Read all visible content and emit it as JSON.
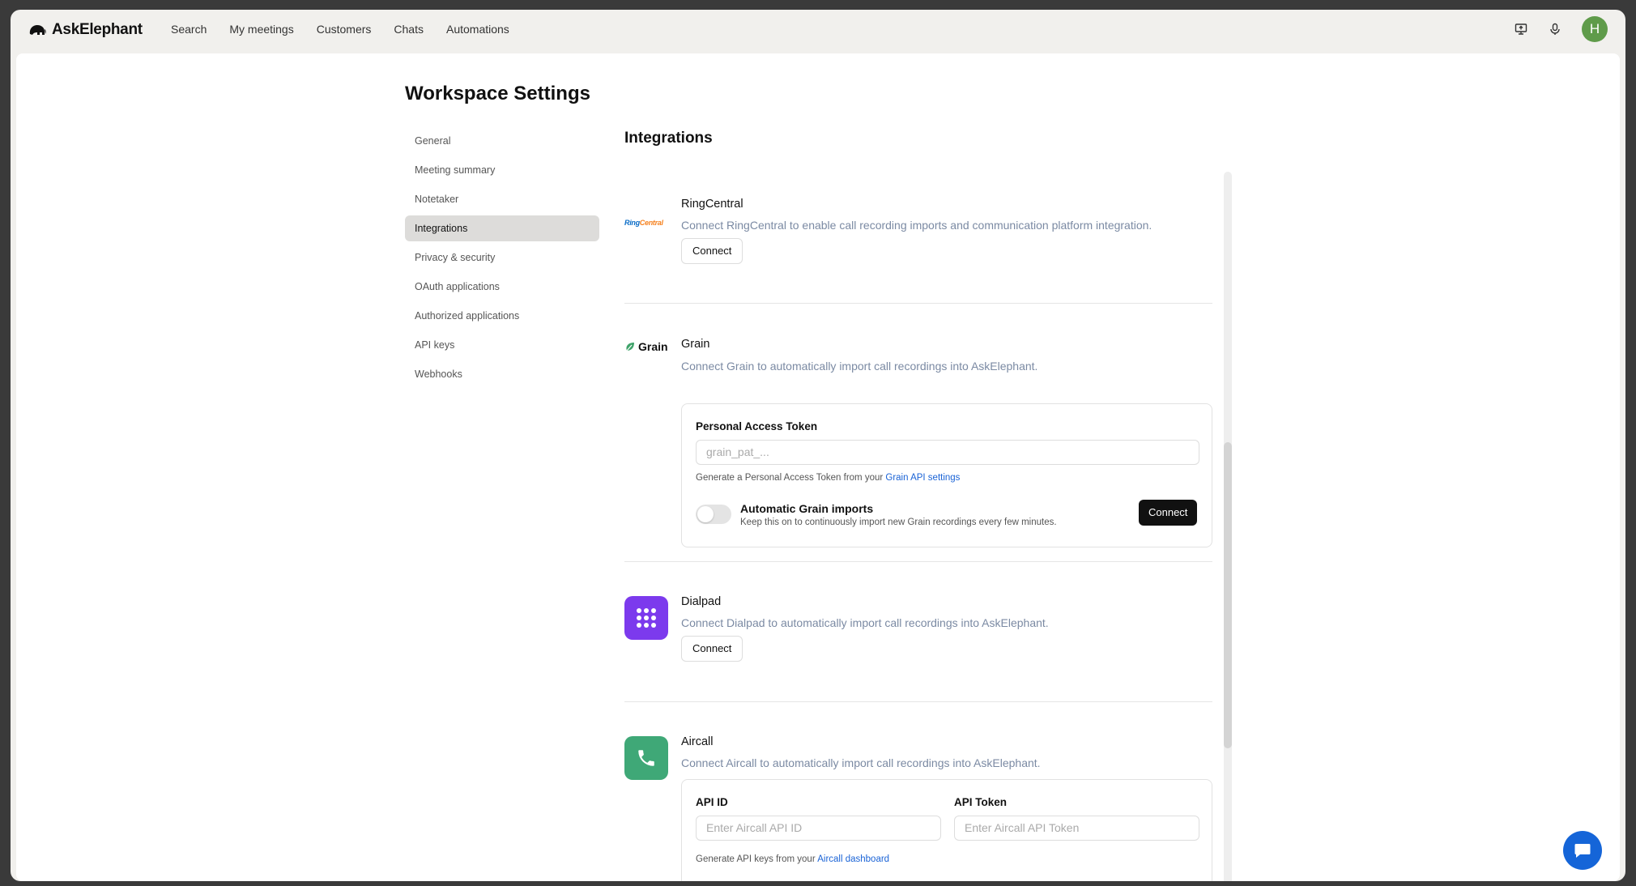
{
  "app": {
    "name": "AskElephant",
    "avatar_initial": "H",
    "avatar_color": "#5f9b4a"
  },
  "nav": {
    "items": [
      "Search",
      "My meetings",
      "Customers",
      "Chats",
      "Automations"
    ]
  },
  "page": {
    "title": "Workspace Settings",
    "section_title": "Integrations"
  },
  "sidebar": {
    "items": [
      {
        "label": "General",
        "active": false
      },
      {
        "label": "Meeting summary",
        "active": false
      },
      {
        "label": "Notetaker",
        "active": false
      },
      {
        "label": "Integrations",
        "active": true
      },
      {
        "label": "Privacy & security",
        "active": false
      },
      {
        "label": "OAuth applications",
        "active": false
      },
      {
        "label": "Authorized applications",
        "active": false
      },
      {
        "label": "API keys",
        "active": false
      },
      {
        "label": "Webhooks",
        "active": false
      }
    ]
  },
  "integrations": {
    "ringcentral": {
      "logo_text": "Ring",
      "logo_text_accent": "Central",
      "name": "RingCentral",
      "description": "Connect RingCentral to enable call recording imports and communication platform integration.",
      "button": "Connect"
    },
    "grain": {
      "logo_text": "Grain",
      "name": "Grain",
      "description": "Connect Grain to automatically import call recordings into AskElephant.",
      "token_label": "Personal Access Token",
      "token_placeholder": "grain_pat_...",
      "hint_prefix": "Generate a Personal Access Token from your",
      "hint_link": "Grain API settings",
      "toggle_title": "Automatic Grain imports",
      "toggle_desc": "Keep this on to continuously import new Grain recordings every few minutes.",
      "toggle_on": false,
      "button": "Connect"
    },
    "dialpad": {
      "name": "Dialpad",
      "description": "Connect Dialpad to automatically import call recordings into AskElephant.",
      "button": "Connect",
      "icon_color": "#7c3aed"
    },
    "aircall": {
      "name": "Aircall",
      "description": "Connect Aircall to automatically import call recordings into AskElephant.",
      "api_id_label": "API ID",
      "api_id_placeholder": "Enter Aircall API ID",
      "api_token_label": "API Token",
      "api_token_placeholder": "Enter Aircall API Token",
      "hint_prefix": "Generate API keys from your",
      "hint_link": "Aircall dashboard",
      "icon_color": "#3fa877"
    }
  }
}
